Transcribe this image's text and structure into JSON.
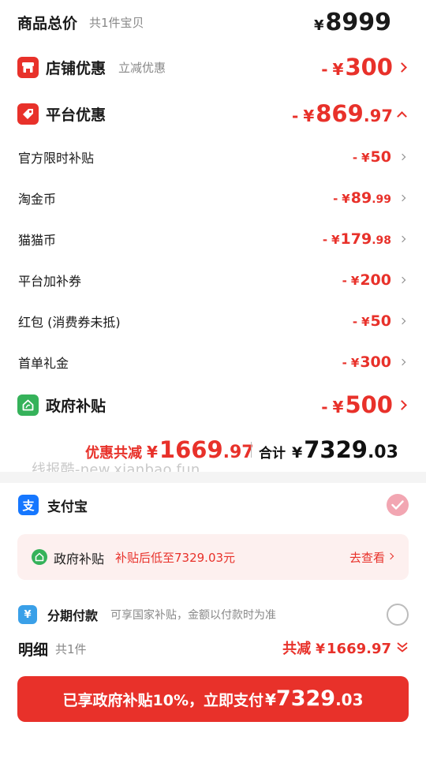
{
  "total": {
    "title": "商品总价",
    "subtitle": "共1件宝贝",
    "currency": "¥",
    "amount": "8999"
  },
  "shop_discount": {
    "label": "店铺优惠",
    "note": "立减优惠",
    "sign": "-",
    "currency": "¥",
    "amount_int": "300",
    "amount_dec": ""
  },
  "platform_discount": {
    "label": "平台优惠",
    "sign": "-",
    "currency": "¥",
    "amount_int": "869",
    "amount_dec": ".97",
    "items": [
      {
        "label": "官方限时补贴",
        "sign": "-",
        "currency": "¥",
        "amount_int": "50",
        "amount_dec": ""
      },
      {
        "label": "淘金币",
        "sign": "-",
        "currency": "¥",
        "amount_int": "89",
        "amount_dec": ".99"
      },
      {
        "label": "猫猫币",
        "sign": "-",
        "currency": "¥",
        "amount_int": "179",
        "amount_dec": ".98"
      },
      {
        "label": "平台加补券",
        "sign": "-",
        "currency": "¥",
        "amount_int": "200",
        "amount_dec": ""
      },
      {
        "label": "红包 (消费券未抵)",
        "sign": "-",
        "currency": "¥",
        "amount_int": "50",
        "amount_dec": ""
      },
      {
        "label": "首单礼金",
        "sign": "-",
        "currency": "¥",
        "amount_int": "300",
        "amount_dec": ""
      }
    ]
  },
  "gov_subsidy": {
    "label": "政府补贴",
    "sign": "-",
    "currency": "¥",
    "amount_int": "500",
    "amount_dec": ""
  },
  "summary": {
    "discount_label": "优惠共减",
    "discount_currency": "¥",
    "discount_int": "1669",
    "discount_dec": ".97",
    "total_label": "合计",
    "total_currency": "¥",
    "total_int": "7329",
    "total_dec": ".03"
  },
  "watermark": "线报酷-new.xianbao.fun",
  "payment": {
    "alipay_label": "支付宝",
    "alipay_icon_glyph": "支",
    "gov_card": {
      "title": "政府补贴",
      "desc": "补贴后低至7329.03元",
      "action": "去查看"
    },
    "installment_label": "分期付款",
    "installment_note": "可享国家补贴，金额以付款时为准",
    "installment_icon_glyph": "¥"
  },
  "detail": {
    "label": "明细",
    "count": "共1件",
    "reduce_label": "共减",
    "currency": "¥",
    "amount": "1669.97"
  },
  "pay_button": {
    "text": "已享政府补贴10%，立即支付",
    "currency": "¥",
    "amount_int": "7329",
    "amount_dec": ".03"
  },
  "colors": {
    "accent": "#e8312a",
    "alipay": "#1677ff",
    "gov_green": "#35b25a",
    "installment": "#3aa0e8",
    "radio_selected": "#f2a6b2"
  },
  "icons": {
    "shop": "shop-icon",
    "platform": "tag-icon",
    "gov": "home-leaf-icon",
    "alipay": "alipay-icon",
    "installment": "installment-icon",
    "check": "check-icon"
  }
}
